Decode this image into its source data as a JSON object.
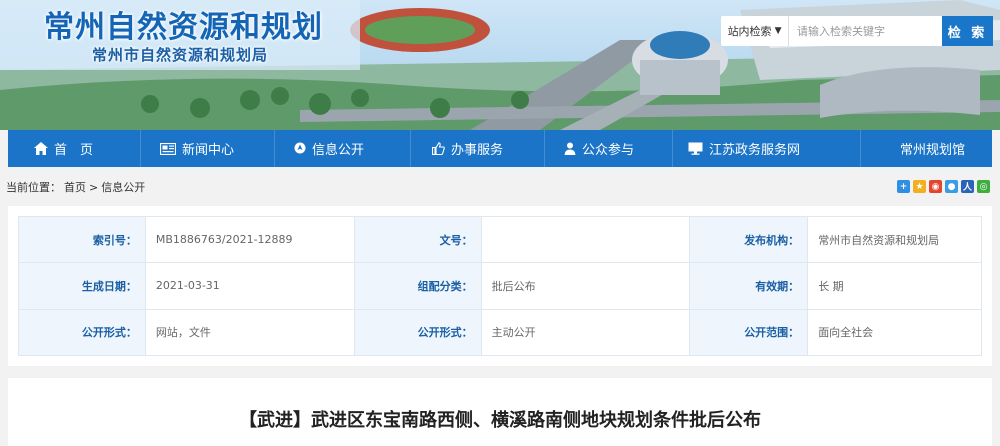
{
  "header": {
    "title": "常州自然资源和规划",
    "subtitle": "常州市自然资源和规划局"
  },
  "search": {
    "scope": "站内检索",
    "placeholder": "请输入检索关键字",
    "button": "检 索"
  },
  "nav": {
    "items": [
      {
        "label": "首　页",
        "icon": "home-icon"
      },
      {
        "label": "新闻中心",
        "icon": "newspaper-icon"
      },
      {
        "label": "信息公开",
        "icon": "location-pin-icon"
      },
      {
        "label": "办事服务",
        "icon": "thumbs-up-icon"
      },
      {
        "label": "公众参与",
        "icon": "person-icon"
      },
      {
        "label": "江苏政务服务网",
        "icon": "monitor-icon"
      },
      {
        "label": "常州规划馆",
        "icon": ""
      }
    ]
  },
  "breadcrumb": {
    "prefix": "当前位置：",
    "home": "首页",
    "sep": ">",
    "current": "信息公开"
  },
  "share_icons": [
    "plus-share-icon",
    "qzone-icon",
    "weibo-icon",
    "qq-icon",
    "renren-icon",
    "wechat-icon"
  ],
  "meta": {
    "index_label": "索引号：",
    "index_value": "MB1886763/2021-12889",
    "docno_label": "文号：",
    "docno_value": "",
    "publisher_label": "发布机构：",
    "publisher_value": "常州市自然资源和规划局",
    "date_label": "生成日期：",
    "date_value": "2021-03-31",
    "category_label": "组配分类：",
    "category_value": "批后公布",
    "validity_label": "有效期：",
    "validity_value": "长 期",
    "form_label": "公开形式：",
    "form_value": "网站，文件",
    "mode_label": "公开形式：",
    "mode_value": "主动公开",
    "scope_label": "公开范围：",
    "scope_value": "面向全社会"
  },
  "article": {
    "title": "【武进】武进区东宝南路西侧、横溪路南侧地块规划条件批后公布"
  },
  "colors": {
    "nav_bg": "#1b74c8",
    "key_text": "#1a5fa5",
    "key_bg": "#eef5fc"
  }
}
